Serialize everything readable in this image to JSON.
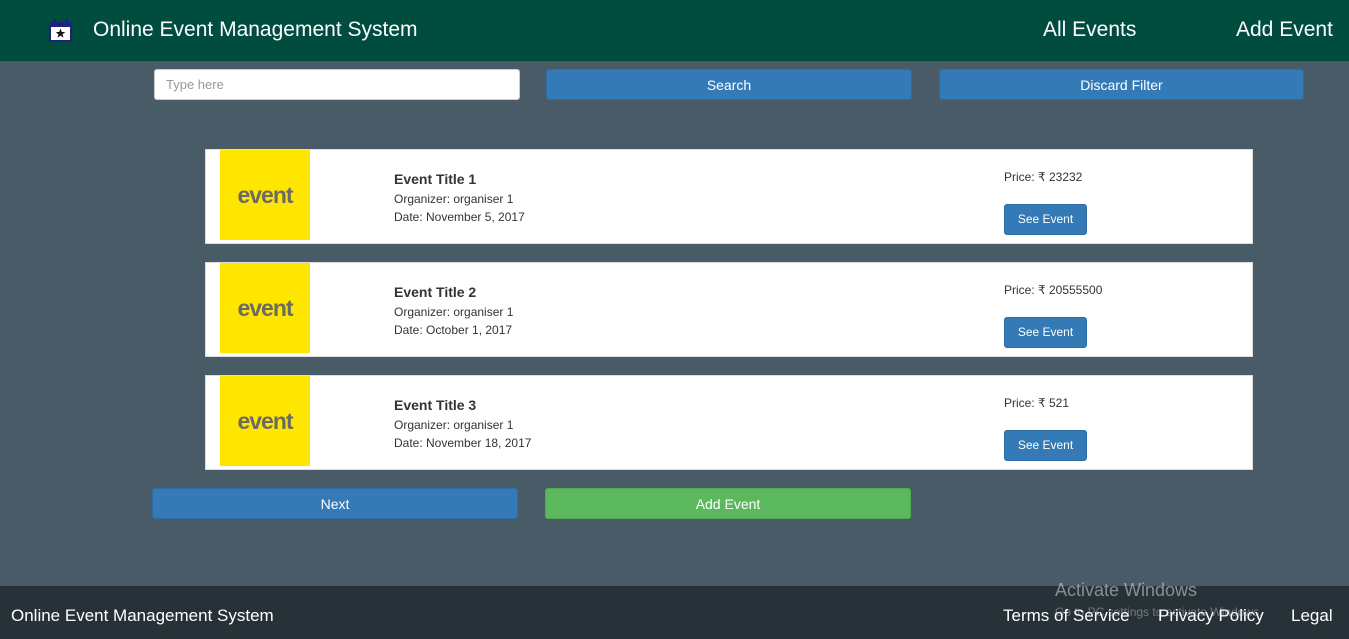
{
  "header": {
    "brand_icon": "calendar-star-icon",
    "title": "Online Event Management System",
    "nav": [
      {
        "label": "All Events"
      },
      {
        "label": "Add Event"
      }
    ]
  },
  "search": {
    "placeholder": "Type here",
    "value": "",
    "search_label": "Search",
    "discard_label": "Discard Filter"
  },
  "events": [
    {
      "thumbnail_text": "event",
      "title": "Event Title 1",
      "organizer": "Organizer: organiser 1",
      "date": "Date: November 5, 2017",
      "price": "Price: ₹ 23232",
      "action_label": "See Event"
    },
    {
      "thumbnail_text": "event",
      "title": "Event Title 2",
      "organizer": "Organizer: organiser 1",
      "date": "Date: October 1, 2017",
      "price": "Price: ₹ 20555500",
      "action_label": "See Event"
    },
    {
      "thumbnail_text": "event",
      "title": "Event Title 3",
      "organizer": "Organizer: organiser 1",
      "date": "Date: November 18, 2017",
      "price": "Price: ₹ 521",
      "action_label": "See Event"
    }
  ],
  "pagination": {
    "next_label": "Next",
    "add_event_label": "Add Event"
  },
  "footer": {
    "title": "Online Event Management System",
    "links": [
      {
        "label": "Terms of Service"
      },
      {
        "label": "Privacy Policy"
      },
      {
        "label": "Legal"
      }
    ]
  },
  "watermark": {
    "title": "Activate Windows",
    "subtitle": "Go to PC settings to activate Windows."
  },
  "colors": {
    "header_bg": "#004d40",
    "page_bg": "#485b66",
    "footer_bg": "#263238",
    "primary": "#337ab7",
    "success": "#5cb85c",
    "thumbnail_bg": "#ffe600"
  }
}
